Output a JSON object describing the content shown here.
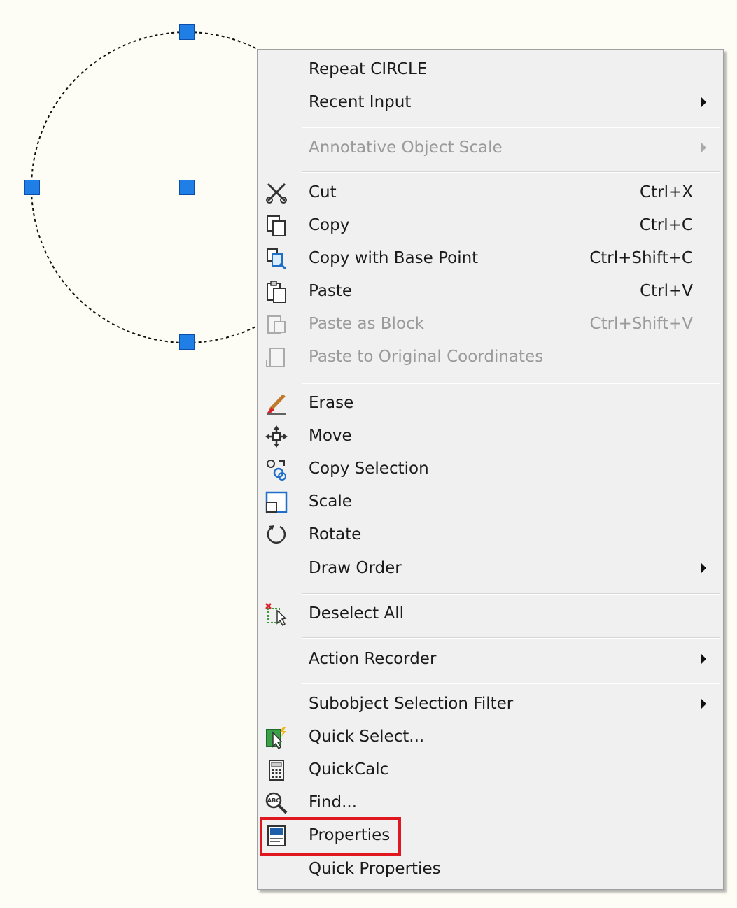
{
  "colors": {
    "grip": "#1f7fe6",
    "highlight": "#e0171f",
    "menu_bg": "#f0f0f0",
    "canvas_bg": "#fdfdf5"
  },
  "menu": {
    "items": [
      {
        "label": "Repeat CIRCLE",
        "shortcut": "",
        "icon": "",
        "disabled": false,
        "submenu": false
      },
      {
        "label": "Recent Input",
        "shortcut": "",
        "icon": "",
        "disabled": false,
        "submenu": true
      },
      {
        "label": "Annotative Object Scale",
        "shortcut": "",
        "icon": "",
        "disabled": true,
        "submenu": true
      },
      {
        "label": "Cut",
        "shortcut": "Ctrl+X",
        "icon": "scissors-icon",
        "disabled": false,
        "submenu": false
      },
      {
        "label": "Copy",
        "shortcut": "Ctrl+C",
        "icon": "copy-icon",
        "disabled": false,
        "submenu": false
      },
      {
        "label": "Copy with Base Point",
        "shortcut": "Ctrl+Shift+C",
        "icon": "copy-base-point-icon",
        "disabled": false,
        "submenu": false
      },
      {
        "label": "Paste",
        "shortcut": "Ctrl+V",
        "icon": "paste-icon",
        "disabled": false,
        "submenu": false
      },
      {
        "label": "Paste as Block",
        "shortcut": "Ctrl+Shift+V",
        "icon": "paste-block-icon",
        "disabled": true,
        "submenu": false
      },
      {
        "label": "Paste to Original Coordinates",
        "shortcut": "",
        "icon": "paste-coordinates-icon",
        "disabled": true,
        "submenu": false
      },
      {
        "label": "Erase",
        "shortcut": "",
        "icon": "eraser-icon",
        "disabled": false,
        "submenu": false
      },
      {
        "label": "Move",
        "shortcut": "",
        "icon": "move-icon",
        "disabled": false,
        "submenu": false
      },
      {
        "label": "Copy Selection",
        "shortcut": "",
        "icon": "copy-selection-icon",
        "disabled": false,
        "submenu": false
      },
      {
        "label": "Scale",
        "shortcut": "",
        "icon": "scale-icon",
        "disabled": false,
        "submenu": false
      },
      {
        "label": "Rotate",
        "shortcut": "",
        "icon": "rotate-icon",
        "disabled": false,
        "submenu": false
      },
      {
        "label": "Draw Order",
        "shortcut": "",
        "icon": "",
        "disabled": false,
        "submenu": true
      },
      {
        "label": "Deselect All",
        "shortcut": "",
        "icon": "deselect-icon",
        "disabled": false,
        "submenu": false
      },
      {
        "label": "Action Recorder",
        "shortcut": "",
        "icon": "",
        "disabled": false,
        "submenu": true
      },
      {
        "label": "Subobject Selection Filter",
        "shortcut": "",
        "icon": "",
        "disabled": false,
        "submenu": true
      },
      {
        "label": "Quick Select...",
        "shortcut": "",
        "icon": "quick-select-icon",
        "disabled": false,
        "submenu": false
      },
      {
        "label": "QuickCalc",
        "shortcut": "",
        "icon": "calculator-icon",
        "disabled": false,
        "submenu": false
      },
      {
        "label": "Find...",
        "shortcut": "",
        "icon": "find-icon",
        "disabled": false,
        "submenu": false
      },
      {
        "label": "Properties",
        "shortcut": "",
        "icon": "properties-icon",
        "disabled": false,
        "submenu": false,
        "highlighted": true
      },
      {
        "label": "Quick Properties",
        "shortcut": "",
        "icon": "",
        "disabled": false,
        "submenu": false
      }
    ]
  }
}
